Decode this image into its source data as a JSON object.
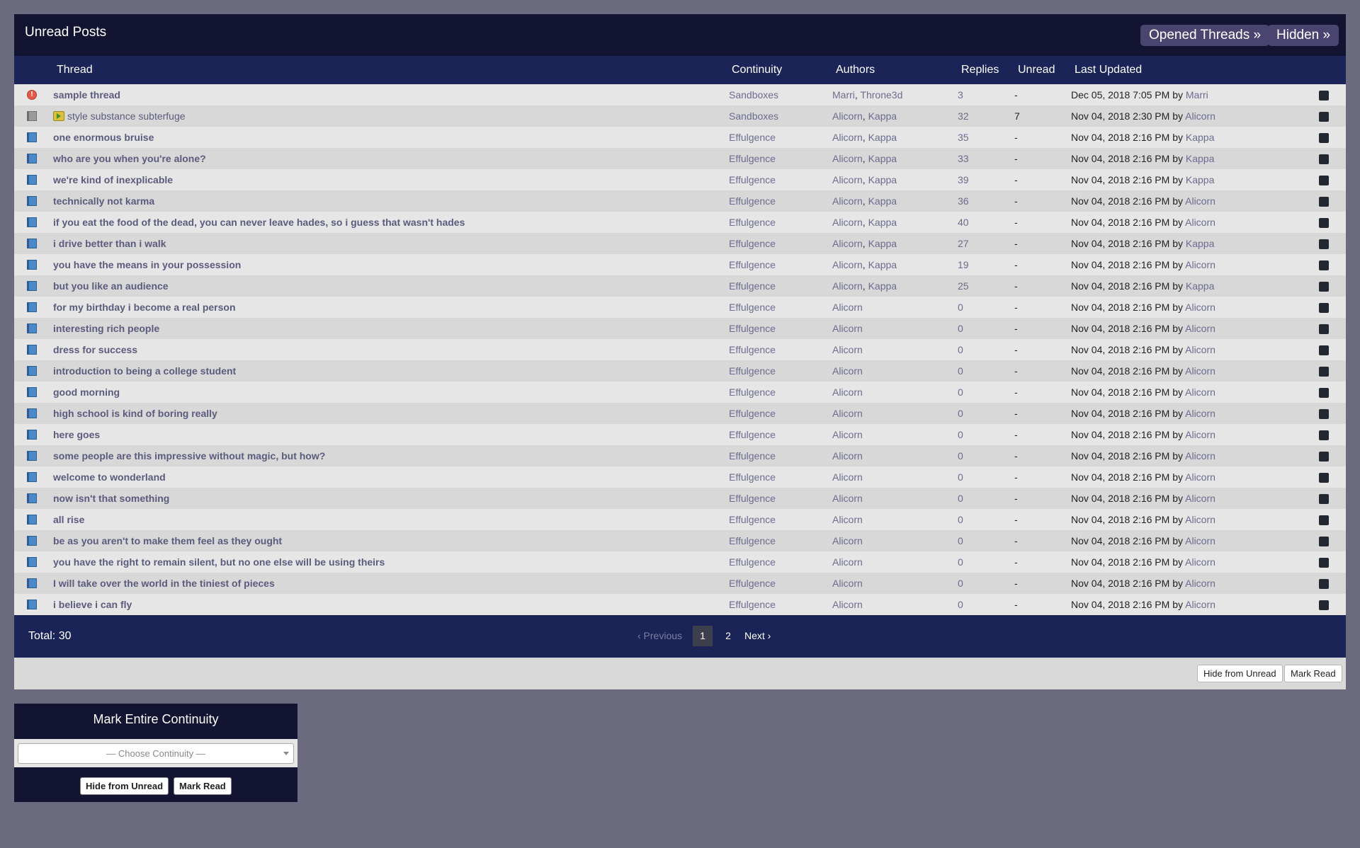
{
  "header": {
    "title": "Unread Posts",
    "opened_threads_label": "Opened Threads »",
    "hidden_label": "Hidden »"
  },
  "columns": {
    "thread": "Thread",
    "continuity": "Continuity",
    "authors": "Authors",
    "replies": "Replies",
    "unread": "Unread",
    "last_updated": "Last Updated"
  },
  "rows": [
    {
      "icon": "alert",
      "title": "sample thread",
      "continuity": "Sandboxes",
      "authors": [
        "Marri",
        "Throne3d"
      ],
      "replies": "3",
      "unread": "-",
      "date": "Dec 05, 2018 7:05 PM",
      "by": "by",
      "last_user": "Marri"
    },
    {
      "icon": "grey",
      "badge": "arrow",
      "title": "style substance subterfuge",
      "continuity": "Sandboxes",
      "authors": [
        "Alicorn",
        "Kappa"
      ],
      "replies": "32",
      "unread": "7",
      "date": "Nov 04, 2018 2:30 PM",
      "by": "by",
      "last_user": "Alicorn"
    },
    {
      "icon": "book",
      "title": "one enormous bruise",
      "continuity": "Effulgence",
      "authors": [
        "Alicorn",
        "Kappa"
      ],
      "replies": "35",
      "unread": "-",
      "date": "Nov 04, 2018 2:16 PM",
      "by": "by",
      "last_user": "Kappa"
    },
    {
      "icon": "book",
      "title": "who are you when you're alone?",
      "continuity": "Effulgence",
      "authors": [
        "Alicorn",
        "Kappa"
      ],
      "replies": "33",
      "unread": "-",
      "date": "Nov 04, 2018 2:16 PM",
      "by": "by",
      "last_user": "Kappa"
    },
    {
      "icon": "book",
      "title": "we're kind of inexplicable",
      "continuity": "Effulgence",
      "authors": [
        "Alicorn",
        "Kappa"
      ],
      "replies": "39",
      "unread": "-",
      "date": "Nov 04, 2018 2:16 PM",
      "by": "by",
      "last_user": "Kappa"
    },
    {
      "icon": "book",
      "title": "technically not karma",
      "continuity": "Effulgence",
      "authors": [
        "Alicorn",
        "Kappa"
      ],
      "replies": "36",
      "unread": "-",
      "date": "Nov 04, 2018 2:16 PM",
      "by": "by",
      "last_user": "Alicorn"
    },
    {
      "icon": "book",
      "title": "if you eat the food of the dead, you can never leave hades, so i guess that wasn't hades",
      "continuity": "Effulgence",
      "authors": [
        "Alicorn",
        "Kappa"
      ],
      "replies": "40",
      "unread": "-",
      "date": "Nov 04, 2018 2:16 PM",
      "by": "by",
      "last_user": "Alicorn"
    },
    {
      "icon": "book",
      "title": "i drive better than i walk",
      "continuity": "Effulgence",
      "authors": [
        "Alicorn",
        "Kappa"
      ],
      "replies": "27",
      "unread": "-",
      "date": "Nov 04, 2018 2:16 PM",
      "by": "by",
      "last_user": "Kappa"
    },
    {
      "icon": "book",
      "title": "you have the means in your possession",
      "continuity": "Effulgence",
      "authors": [
        "Alicorn",
        "Kappa"
      ],
      "replies": "19",
      "unread": "-",
      "date": "Nov 04, 2018 2:16 PM",
      "by": "by",
      "last_user": "Alicorn"
    },
    {
      "icon": "book",
      "title": "but you like an audience",
      "continuity": "Effulgence",
      "authors": [
        "Alicorn",
        "Kappa"
      ],
      "replies": "25",
      "unread": "-",
      "date": "Nov 04, 2018 2:16 PM",
      "by": "by",
      "last_user": "Kappa"
    },
    {
      "icon": "book",
      "title": "for my birthday i become a real person",
      "continuity": "Effulgence",
      "authors": [
        "Alicorn"
      ],
      "replies": "0",
      "unread": "-",
      "date": "Nov 04, 2018 2:16 PM",
      "by": "by",
      "last_user": "Alicorn"
    },
    {
      "icon": "book",
      "title": "interesting rich people",
      "continuity": "Effulgence",
      "authors": [
        "Alicorn"
      ],
      "replies": "0",
      "unread": "-",
      "date": "Nov 04, 2018 2:16 PM",
      "by": "by",
      "last_user": "Alicorn"
    },
    {
      "icon": "book",
      "title": "dress for success",
      "continuity": "Effulgence",
      "authors": [
        "Alicorn"
      ],
      "replies": "0",
      "unread": "-",
      "date": "Nov 04, 2018 2:16 PM",
      "by": "by",
      "last_user": "Alicorn"
    },
    {
      "icon": "book",
      "title": "introduction to being a college student",
      "continuity": "Effulgence",
      "authors": [
        "Alicorn"
      ],
      "replies": "0",
      "unread": "-",
      "date": "Nov 04, 2018 2:16 PM",
      "by": "by",
      "last_user": "Alicorn"
    },
    {
      "icon": "book",
      "title": "good morning",
      "continuity": "Effulgence",
      "authors": [
        "Alicorn"
      ],
      "replies": "0",
      "unread": "-",
      "date": "Nov 04, 2018 2:16 PM",
      "by": "by",
      "last_user": "Alicorn"
    },
    {
      "icon": "book",
      "title": "high school is kind of boring really",
      "continuity": "Effulgence",
      "authors": [
        "Alicorn"
      ],
      "replies": "0",
      "unread": "-",
      "date": "Nov 04, 2018 2:16 PM",
      "by": "by",
      "last_user": "Alicorn"
    },
    {
      "icon": "book",
      "title": "here goes",
      "continuity": "Effulgence",
      "authors": [
        "Alicorn"
      ],
      "replies": "0",
      "unread": "-",
      "date": "Nov 04, 2018 2:16 PM",
      "by": "by",
      "last_user": "Alicorn"
    },
    {
      "icon": "book",
      "title": "some people are this impressive without magic, but how?",
      "continuity": "Effulgence",
      "authors": [
        "Alicorn"
      ],
      "replies": "0",
      "unread": "-",
      "date": "Nov 04, 2018 2:16 PM",
      "by": "by",
      "last_user": "Alicorn"
    },
    {
      "icon": "book",
      "title": "welcome to wonderland",
      "continuity": "Effulgence",
      "authors": [
        "Alicorn"
      ],
      "replies": "0",
      "unread": "-",
      "date": "Nov 04, 2018 2:16 PM",
      "by": "by",
      "last_user": "Alicorn"
    },
    {
      "icon": "book",
      "title": "now isn't that something",
      "continuity": "Effulgence",
      "authors": [
        "Alicorn"
      ],
      "replies": "0",
      "unread": "-",
      "date": "Nov 04, 2018 2:16 PM",
      "by": "by",
      "last_user": "Alicorn"
    },
    {
      "icon": "book",
      "title": "all rise",
      "continuity": "Effulgence",
      "authors": [
        "Alicorn"
      ],
      "replies": "0",
      "unread": "-",
      "date": "Nov 04, 2018 2:16 PM",
      "by": "by",
      "last_user": "Alicorn"
    },
    {
      "icon": "book",
      "title": "be as you aren't to make them feel as they ought",
      "continuity": "Effulgence",
      "authors": [
        "Alicorn"
      ],
      "replies": "0",
      "unread": "-",
      "date": "Nov 04, 2018 2:16 PM",
      "by": "by",
      "last_user": "Alicorn"
    },
    {
      "icon": "book",
      "title": "you have the right to remain silent, but no one else will be using theirs",
      "continuity": "Effulgence",
      "authors": [
        "Alicorn"
      ],
      "replies": "0",
      "unread": "-",
      "date": "Nov 04, 2018 2:16 PM",
      "by": "by",
      "last_user": "Alicorn"
    },
    {
      "icon": "book",
      "title": "I will take over the world in the tiniest of pieces",
      "continuity": "Effulgence",
      "authors": [
        "Alicorn"
      ],
      "replies": "0",
      "unread": "-",
      "date": "Nov 04, 2018 2:16 PM",
      "by": "by",
      "last_user": "Alicorn"
    },
    {
      "icon": "book",
      "title": "i believe i can fly",
      "continuity": "Effulgence",
      "authors": [
        "Alicorn"
      ],
      "replies": "0",
      "unread": "-",
      "date": "Nov 04, 2018 2:16 PM",
      "by": "by",
      "last_user": "Alicorn"
    }
  ],
  "footer": {
    "total": "Total: 30",
    "pagination": {
      "previous": "‹ Previous",
      "pages": [
        "1",
        "2"
      ],
      "current": "1",
      "next": "Next ›"
    }
  },
  "actions": {
    "hide_label": "Hide from Unread",
    "mark_read_label": "Mark Read"
  },
  "mark_continuity": {
    "title": "Mark Entire Continuity",
    "select_value": "— Choose Continuity —",
    "hide_label": "Hide from Unread",
    "mark_read_label": "Mark Read"
  },
  "colors": {
    "page_background": "#6b6a7f",
    "header_dark": "#131432",
    "table_header": "#1a2457",
    "link_text": "#6c6c90",
    "row_light": "#e6e6e6",
    "row_dark": "#d8d8d8"
  }
}
